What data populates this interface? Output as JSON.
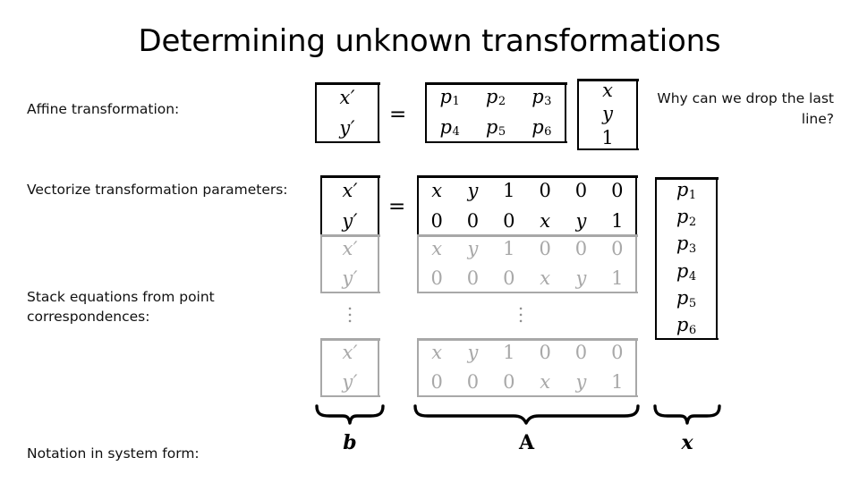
{
  "slide": {
    "title": "Determining unknown transformations",
    "background_color": "#ffffff",
    "text_color": "#111111",
    "faded_color": "#a8a8a8"
  },
  "labels": {
    "affine": "Affine transformation:",
    "vectorize": "Vectorize transformation parameters:",
    "stack": "Stack equations from point correspondences:",
    "notation": "Notation in system form:"
  },
  "side_note": "Why can we drop the last line?",
  "equation1": {
    "lhs": [
      "x′",
      "y′"
    ],
    "operator": "=",
    "matrix": [
      [
        "p",
        "p",
        "p"
      ],
      [
        "p",
        "p",
        "p"
      ]
    ],
    "matrix_subs": [
      [
        "1",
        "2",
        "3"
      ],
      [
        "4",
        "5",
        "6"
      ]
    ],
    "rhs_vector": [
      "x",
      "y",
      "1"
    ]
  },
  "equation2": {
    "operator": "=",
    "lhs_block_dark": [
      "x′",
      "y′"
    ],
    "lhs_block_gray": [
      "x′",
      "y′"
    ],
    "lhs_block_last": [
      "x′",
      "y′"
    ],
    "A_block_dark": [
      [
        "x",
        "y",
        "1",
        "0",
        "0",
        "0"
      ],
      [
        "0",
        "0",
        "0",
        "x",
        "y",
        "1"
      ]
    ],
    "A_block_gray": [
      [
        "x",
        "y",
        "1",
        "0",
        "0",
        "0"
      ],
      [
        "0",
        "0",
        "0",
        "x",
        "y",
        "1"
      ]
    ],
    "A_block_last": [
      [
        "x",
        "y",
        "1",
        "0",
        "0",
        "0"
      ],
      [
        "0",
        "0",
        "0",
        "x",
        "y",
        "1"
      ]
    ],
    "ellipsis": "⋮",
    "p_vector": [
      "p",
      "p",
      "p",
      "p",
      "p",
      "p"
    ],
    "p_vector_subs": [
      "1",
      "2",
      "3",
      "4",
      "5",
      "6"
    ]
  },
  "braces": [
    {
      "label": "b",
      "style": "italic",
      "name": "brace-b"
    },
    {
      "label": "A",
      "style": "upright",
      "name": "brace-A"
    },
    {
      "label": "x",
      "style": "italic",
      "name": "brace-x"
    }
  ]
}
